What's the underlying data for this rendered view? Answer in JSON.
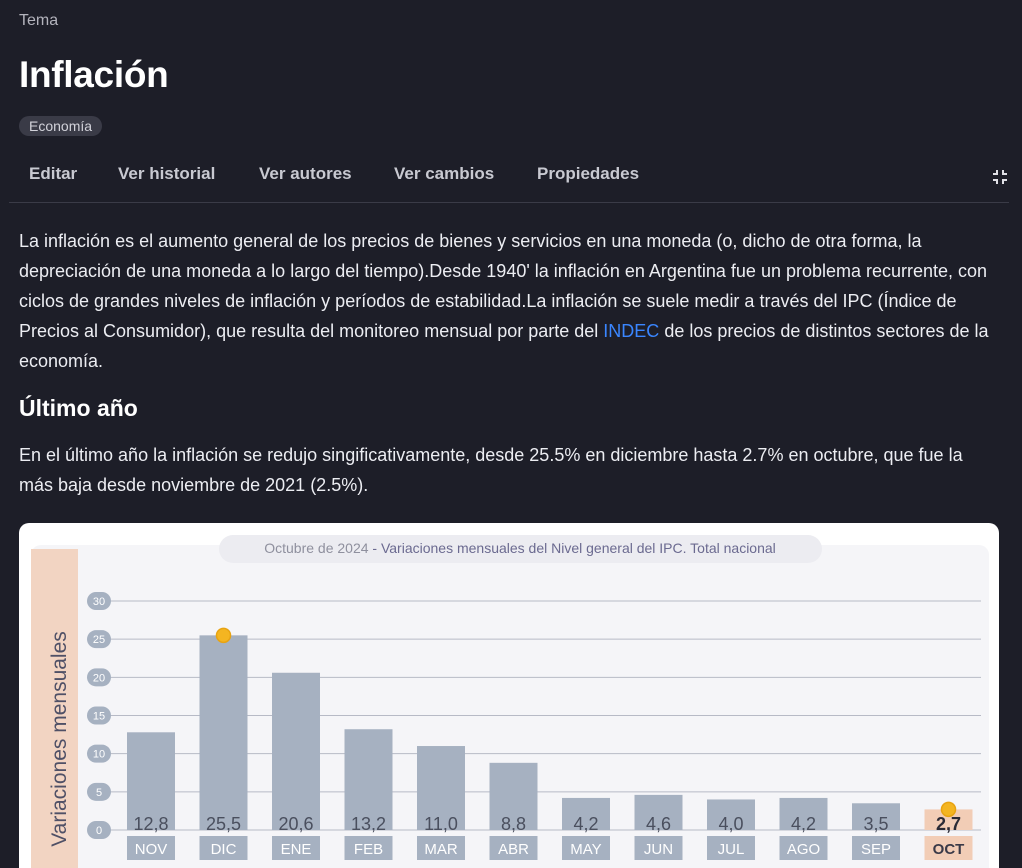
{
  "header": {
    "tema_label": "Tema",
    "title": "Inflación",
    "badge": "Economía"
  },
  "tabs": [
    {
      "label": "Editar"
    },
    {
      "label": "Ver historial"
    },
    {
      "label": "Ver autores"
    },
    {
      "label": "Ver cambios"
    },
    {
      "label": "Propiedades"
    }
  ],
  "content": {
    "intro_before_link": "La inflación es el aumento general de los precios de bienes y servicios en una moneda (o, dicho de otra forma, la depreciación de una moneda a lo largo del tiempo).Desde 1940' la inflación en Argentina fue un problema recurrente, con ciclos de grandes niveles de inflación y períodos de estabilidad.La inflación se suele medir a través del IPC (Índice de Precios al Consumidor), que resulta del monitoreo mensual por parte del ",
    "intro_link": "INDEC",
    "intro_after_link": " de los precios de distintos sectores de la economía.",
    "section_title": "Último año",
    "section_text": "En el último año la inflación se redujo singificativamente, desde 25.5% en diciembre hasta 2.7% en octubre, que fue la más baja desde noviembre de 2021 (2.5%)."
  },
  "colors": {
    "bar": "#a6b1c1",
    "highlight_bar": "#f2cdb6",
    "marker": "#f4b521",
    "ylabel_band": "#f2d4c2",
    "tick_pill": "#a6b1c1",
    "link": "#3a86ff"
  },
  "chart_data": {
    "type": "bar",
    "title_prefix": "Octubre de 2024",
    "title": " - Variaciones mensuales del Nivel general del IPC. Total nacional",
    "ylabel": "Variaciones mensuales",
    "ylim": [
      0,
      30
    ],
    "yticks": [
      "0",
      "5",
      "10",
      "15",
      "20",
      "25",
      "30"
    ],
    "grid": true,
    "categories": [
      "NOV",
      "DIC",
      "ENE",
      "FEB",
      "MAR",
      "ABR",
      "MAY",
      "JUN",
      "JUL",
      "AGO",
      "SEP",
      "OCT"
    ],
    "values": [
      12.8,
      25.5,
      20.6,
      13.2,
      11.0,
      8.8,
      4.2,
      4.6,
      4.0,
      4.2,
      3.5,
      2.7
    ],
    "value_labels": [
      "12,8",
      "25,5",
      "20,6",
      "13,2",
      "11,0",
      "8,8",
      "4,2",
      "4,6",
      "4,0",
      "4,2",
      "3,5",
      "2,7"
    ],
    "highlighted_category": "OCT",
    "marked_categories": [
      "DIC",
      "OCT"
    ]
  }
}
